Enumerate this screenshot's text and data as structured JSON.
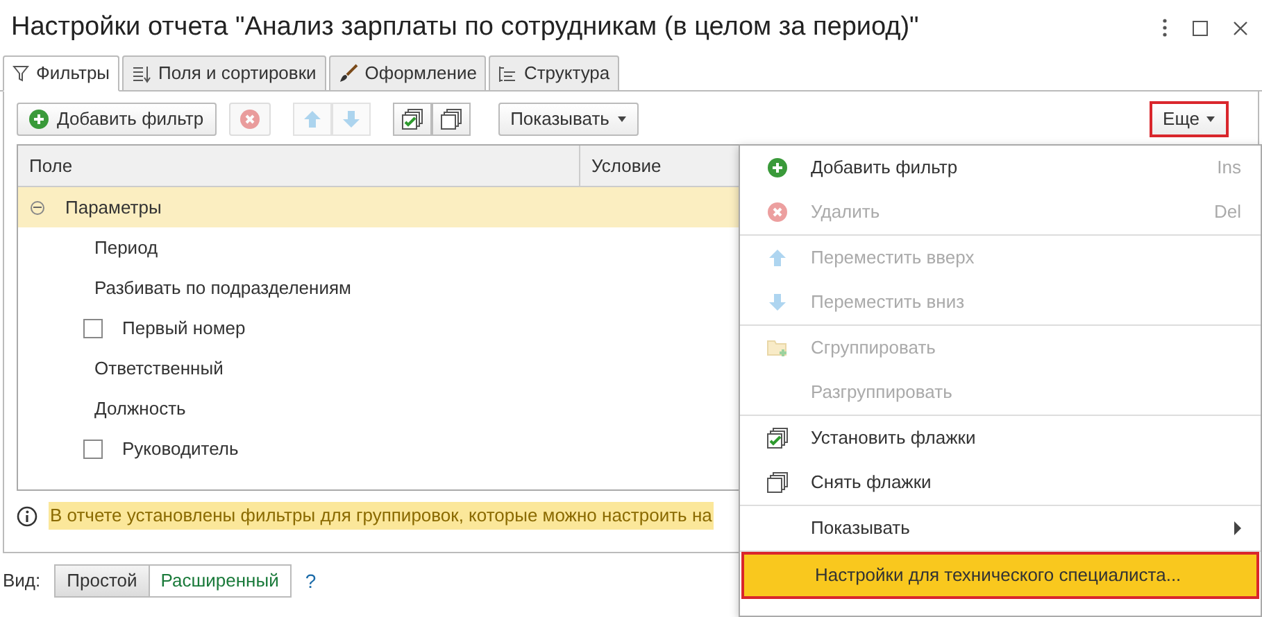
{
  "window": {
    "title": "Настройки отчета \"Анализ зарплаты по сотрудникам (в целом за период)\""
  },
  "tabs": [
    {
      "label": "Фильтры",
      "selected": true
    },
    {
      "label": "Поля и сортировки",
      "selected": false
    },
    {
      "label": "Оформление",
      "selected": false
    },
    {
      "label": "Структура",
      "selected": false
    }
  ],
  "toolbar": {
    "add_button": "Добавить фильтр",
    "show_button": "Показывать",
    "more_button": "Еще"
  },
  "table": {
    "columns": [
      "Поле",
      "Условие"
    ],
    "rows": [
      {
        "label": "Параметры",
        "expanded": true,
        "selected": true,
        "children": [
          {
            "label": "Период",
            "kind": "plain"
          },
          {
            "label": "Разбивать по подразделениям",
            "kind": "plain"
          },
          {
            "label": "Первый номер",
            "kind": "checkbox",
            "checked": false
          },
          {
            "label": "Ответственный",
            "kind": "plain"
          },
          {
            "label": "Должность",
            "kind": "plain"
          },
          {
            "label": "Руководитель",
            "kind": "checkbox",
            "checked": false
          }
        ]
      }
    ]
  },
  "info": "В отчете установлены фильтры для группировок, которые можно настроить на",
  "view": {
    "label": "Вид:",
    "options": [
      {
        "label": "Простой",
        "selected": true
      },
      {
        "label": "Расширенный",
        "selected": false
      }
    ],
    "help": "?"
  },
  "menu": {
    "groups": [
      [
        {
          "label": "Добавить фильтр",
          "shortcut": "Ins",
          "disabled": false
        },
        {
          "label": "Удалить",
          "shortcut": "Del",
          "disabled": true
        }
      ],
      [
        {
          "label": "Переместить вверх",
          "disabled": true
        },
        {
          "label": "Переместить вниз",
          "disabled": true
        }
      ],
      [
        {
          "label": "Сгруппировать",
          "disabled": true
        },
        {
          "label": "Разгруппировать",
          "disabled": true
        }
      ],
      [
        {
          "label": "Установить флажки",
          "disabled": false
        },
        {
          "label": "Снять флажки",
          "disabled": false
        }
      ],
      [
        {
          "label": "Показывать",
          "disabled": false,
          "submenu": true
        }
      ],
      [
        {
          "label": "Настройки для технического специалиста...",
          "disabled": false,
          "highlighted": true
        }
      ]
    ]
  }
}
